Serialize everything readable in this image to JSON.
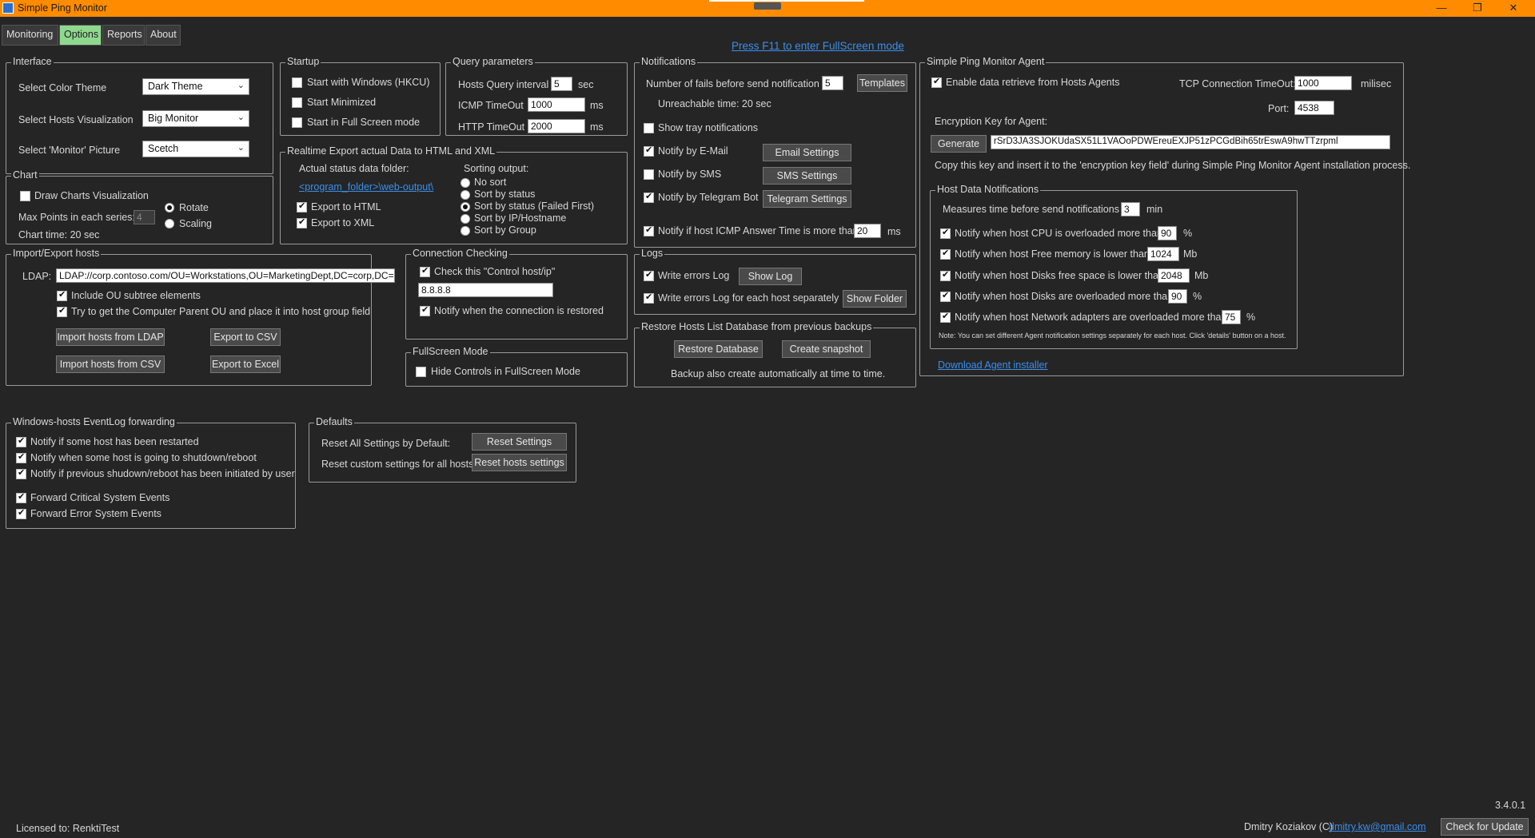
{
  "window": {
    "title": "Simple Ping Monitor",
    "minimize": "—",
    "restore": "❐",
    "close": "✕"
  },
  "tabs": [
    "Monitoring",
    "Options",
    "Reports",
    "About"
  ],
  "fullscreen_hint": "Press F11 to enter FullScreen mode",
  "interface": {
    "title": "Interface",
    "color_theme_label": "Select Color Theme",
    "color_theme": "Dark Theme",
    "visualization_label": "Select Hosts Visualization",
    "visualization": "Big Monitor",
    "picture_label": "Select 'Monitor' Picture",
    "picture": "Scetch"
  },
  "chart": {
    "title": "Chart",
    "draw_label": "Draw Charts Visualization",
    "max_points_label": "Max Points in each series:",
    "max_points": "4",
    "rotate": "Rotate",
    "scaling": "Scaling",
    "chart_time": "Chart time: 20 sec"
  },
  "startup": {
    "title": "Startup",
    "start_windows": "Start with Windows (HKCU)",
    "start_minimized": "Start Minimized",
    "start_fullscreen": "Start in Full Screen mode"
  },
  "query": {
    "title": "Query parameters",
    "interval_label": "Hosts Query interval",
    "interval": "5",
    "interval_unit": "sec",
    "icmp_label": "ICMP TimeOut",
    "icmp": "1000",
    "icmp_unit": "ms",
    "http_label": "HTTP TimeOut",
    "http": "2000",
    "http_unit": "ms"
  },
  "export": {
    "title": "Realtime Export actual Data to HTML and XML",
    "folder_label": "Actual status data folder:",
    "folder_link": "<program_folder>\\web-output\\",
    "export_html": "Export to HTML",
    "export_xml": "Export to XML",
    "sorting_label": "Sorting output:",
    "sort_options": [
      "No sort",
      "Sort by status",
      "Sort by status (Failed First)",
      "Sort by IP/Hostname",
      "Sort by Group"
    ]
  },
  "notifications": {
    "title": "Notifications",
    "fails_label": "Number of fails before send notification",
    "fails": "5",
    "templates_btn": "Templates",
    "unreachable": "Unreachable time: 20 sec",
    "tray": "Show tray notifications",
    "email": "Notify by E-Mail",
    "email_btn": "Email Settings",
    "sms": "Notify by SMS",
    "sms_btn": "SMS Settings",
    "telegram": "Notify by Telegram Bot",
    "telegram_btn": "Telegram Settings",
    "icmp_label": "Notify if host ICMP Answer Time is more than",
    "icmp": "20",
    "icmp_unit": "ms"
  },
  "agent": {
    "title": "Simple Ping Monitor Agent",
    "enable": "Enable data retrieve from Hosts Agents",
    "tcp_label": "TCP Connection TimeOut:",
    "tcp": "1000",
    "tcp_unit": "milisec",
    "port_label": "Port:",
    "port": "4538",
    "key_label": "Encryption Key for Agent:",
    "generate_btn": "Generate",
    "key": "rSrD3JA3SJOKUdaSX51L1VAOoPDWEreuEXJP51zPCGdBih65trEswA9hwTTzrpml",
    "copy_hint": "Copy this key and insert it to the 'encryption key field' during Simple Ping Monitor Agent installation process.",
    "download_link": "Download Agent installer"
  },
  "host_data": {
    "title": "Host Data Notifications",
    "measures_label": "Measures time before send notifications",
    "measures": "3",
    "measures_unit": "min",
    "cpu_label": "Notify when host CPU is overloaded more than",
    "cpu": "90",
    "cpu_unit": "%",
    "mem_label": "Notify when host Free memory is lower than",
    "mem": "1024",
    "mem_unit": "Mb",
    "disk_free_label": "Notify when host Disks free space is lower than",
    "disk_free": "2048",
    "disk_free_unit": "Mb",
    "disk_load_label": "Notify when host Disks are overloaded more than",
    "disk_load": "90",
    "disk_load_unit": "%",
    "net_label": "Notify when host Network adapters are overloaded more than",
    "net": "75",
    "net_unit": "%",
    "note": "Note: You can set different Agent notification settings separately for each host. Click 'details' button on a host."
  },
  "import": {
    "title": "Import/Export hosts",
    "ldap_label": "LDAP:",
    "ldap": "LDAP://corp.contoso.com/OU=Workstations,OU=MarketingDept,DC=corp,DC=contoso,DC=com",
    "ou_subtree": "Include OU subtree elements",
    "parent_ou": "Try to get the Computer Parent OU and place it into host group field",
    "import_ldap_btn": "Import hosts from LDAP",
    "export_csv_btn": "Export to CSV",
    "import_csv_btn": "Import hosts from CSV",
    "export_excel_btn": "Export to Excel"
  },
  "connection": {
    "title": "Connection Checking",
    "check_label": "Check this \"Control host/ip\"",
    "host": "8.8.8.8",
    "restored": "Notify when the connection is restored"
  },
  "fullscreen": {
    "title": "FullScreen Mode",
    "hide": "Hide Controls in FullScreen Mode"
  },
  "logs": {
    "title": "Logs",
    "write": "Write errors Log",
    "show_btn": "Show Log",
    "write_each": "Write errors Log for each host separately",
    "folder_btn": "Show Folder"
  },
  "restore": {
    "title": "Restore Hosts List Database from previous backups",
    "restore_btn": "Restore Database",
    "snapshot_btn": "Create snapshot",
    "note": "Backup also create automatically at time to time."
  },
  "eventlog": {
    "title": "Windows-hosts EventLog forwarding",
    "restarted": "Notify if some host has been restarted",
    "shutdown": "Notify when some host is going to shutdown/reboot",
    "previous": "Notify if previous shudown/reboot has been initiated by user",
    "critical": "Forward Critical System Events",
    "error": "Forward Error System Events"
  },
  "defaults": {
    "title": "Defaults",
    "reset_all_label": "Reset All Settings by Default:",
    "reset_btn": "Reset Settings",
    "reset_custom_label": "Reset custom settings for all hosts:",
    "reset_hosts_btn": "Reset hosts settings"
  },
  "footer": {
    "licensed": "Licensed to: RenktiTest",
    "version": "3.4.0.1",
    "author": "Dmitry Koziakov (C)",
    "email": "dmitry.kw@gmail.com",
    "update_btn": "Check for Update"
  }
}
